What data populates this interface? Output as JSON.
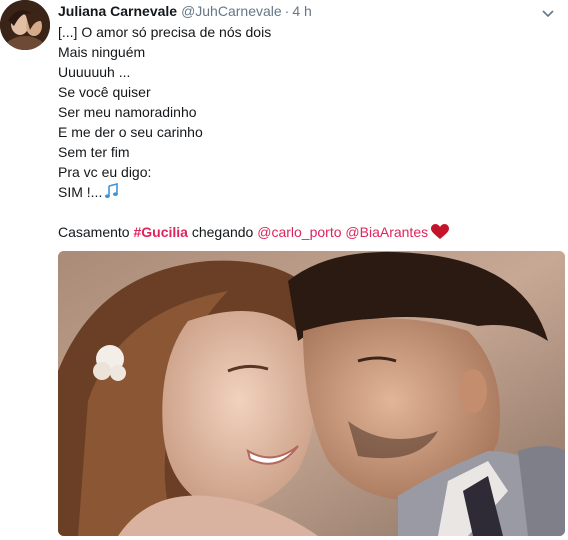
{
  "tweet": {
    "author_name": "Juliana Carnevale",
    "handle": "@JuhCarnevale",
    "separator": "·",
    "time": "4 h",
    "lines": [
      "[...] O amor só precisa de nós dois",
      "Mais ninguém",
      "Uuuuuuh ...",
      "Se você quiser",
      "Ser meu namoradinho",
      "E me der o seu carinho",
      "Sem ter fim",
      "Pra vc eu digo:",
      "SIM !..."
    ],
    "closing": {
      "prefix": "Casamento ",
      "hashtag": "#Gucilia",
      "middle": " chegando ",
      "mention1": "@carlo_porto",
      "mention2": "@BiaArantes"
    },
    "icons": {
      "avatar": "avatar-photo",
      "caret": "chevron-down-icon",
      "notes": "musical-notes-emoji",
      "heart": "red-heart-emoji"
    },
    "colors": {
      "link": "#e0245e",
      "text": "#14171a",
      "secondary": "#657786",
      "heart": "#c3142a",
      "notes": "#3b94d9"
    }
  }
}
